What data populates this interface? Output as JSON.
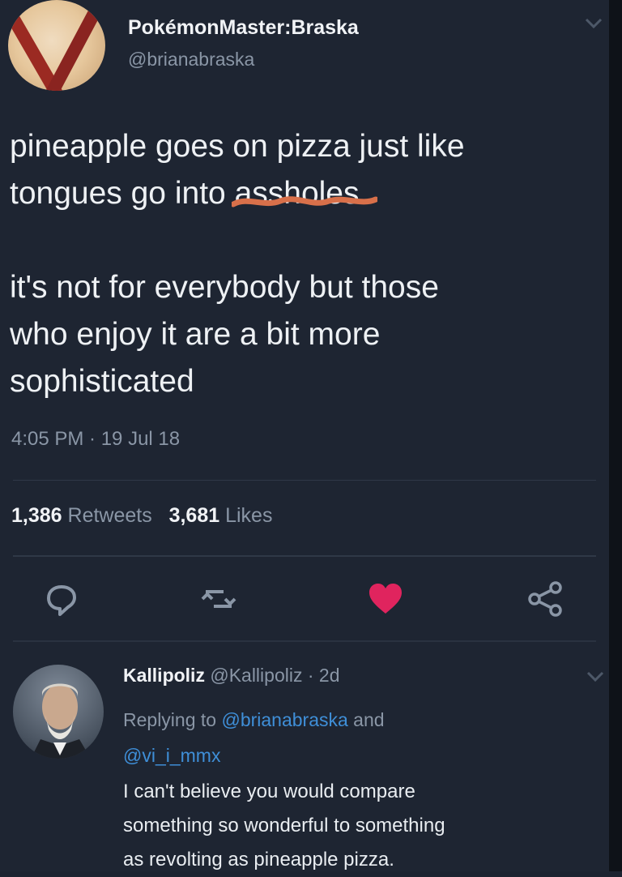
{
  "tweet": {
    "display_name": "PokémonMaster:Braska",
    "handle": "@brianabraska",
    "lines_para1": [
      "pineapple goes on pizza just like",
      "tongues go into "
    ],
    "crossed_word": "assholes",
    "lines_para2": [
      "it's not for everybody but those",
      "who enjoy it are a bit more",
      "sophisticated"
    ],
    "timestamp": "4:05 PM · 19 Jul 18",
    "retweets_count": "1,386",
    "retweets_label": "Retweets",
    "likes_count": "3,681",
    "likes_label": "Likes"
  },
  "actions": {
    "reply_icon": "reply-icon",
    "retweet_icon": "retweet-icon",
    "like_icon": "heart-icon",
    "share_icon": "share-icon",
    "like_color": "#e0245e"
  },
  "reply": {
    "display_name": "Kallipoliz",
    "handle_time": "@Kallipoliz · 2d",
    "replying_prefix": "Replying to ",
    "replying_to_1": "@brianabraska",
    "replying_and": " and",
    "replying_to_2": "@vi_i_mmx",
    "lines": [
      "I can't believe you would compare",
      "something so wonderful to something",
      "as revolting as pineapple pizza."
    ]
  },
  "colors": {
    "background": "#1e2532",
    "link": "#3f8fd8",
    "scribble": "#d8704a"
  }
}
